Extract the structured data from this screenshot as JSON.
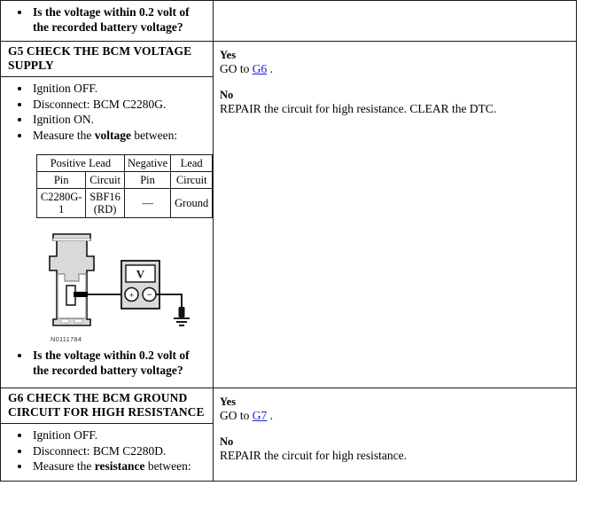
{
  "document": {
    "type": "diagnostic-pinpoint-test",
    "rows": [
      {
        "id": "row-partial-top",
        "left": {
          "kind": "question",
          "items": [
            "Is the voltage within 0.2 volt of the recorded battery voltage?"
          ]
        },
        "right": {
          "kind": "empty",
          "blocks": []
        }
      },
      {
        "id": "row-g5",
        "title": "G5 CHECK THE BCM VOLTAGE SUPPLY",
        "left": {
          "kind": "steps",
          "items": [
            "Ignition OFF.",
            "Disconnect: BCM C2280G.",
            "Ignition ON.",
            "Measure the voltage between:"
          ],
          "measure_bold_word": "voltage",
          "table": {
            "group_headers": [
              "Positive Lead",
              "Negative Lead"
            ],
            "column_headers": [
              "Pin",
              "Circuit",
              "Pin",
              "Circuit"
            ],
            "rows": [
              [
                "C2280G-1",
                "SBF16 (RD)",
                "—",
                "Ground"
              ]
            ]
          },
          "figure": {
            "id": "N0111784",
            "meter_label": "V",
            "positive_terminal": "+",
            "negative_terminal": "−",
            "caption": "connector-voltmeter-ground-schematic"
          },
          "question": "Is the voltage within 0.2 volt of the recorded battery voltage?"
        },
        "right": {
          "kind": "answers",
          "blocks": [
            {
              "label": "Yes",
              "text_before": "GO to ",
              "link": "G6",
              "text_after": " ."
            },
            {
              "label": "No",
              "text_before": "REPAIR the circuit for high resistance. CLEAR the DTC.",
              "link": "",
              "text_after": ""
            }
          ]
        }
      },
      {
        "id": "row-g6",
        "title": "G6 CHECK THE BCM GROUND CIRCUIT FOR HIGH RESISTANCE",
        "left": {
          "kind": "steps",
          "items": [
            "Ignition OFF.",
            "Disconnect: BCM C2280D.",
            "Measure the resistance between:"
          ],
          "measure_bold_word": "resistance"
        },
        "right": {
          "kind": "answers",
          "blocks": [
            {
              "label": "Yes",
              "text_before": "GO to ",
              "link": "G7",
              "text_after": " ."
            },
            {
              "label": "No",
              "text_before": "REPAIR the circuit for high resistance.",
              "link": "",
              "text_after": ""
            }
          ]
        }
      }
    ]
  },
  "colors": {
    "border": "#1a1a1a",
    "link": "#2020c8",
    "text": "#000000",
    "figure_line": "#000000",
    "figure_fill": "#d9d9d9"
  }
}
